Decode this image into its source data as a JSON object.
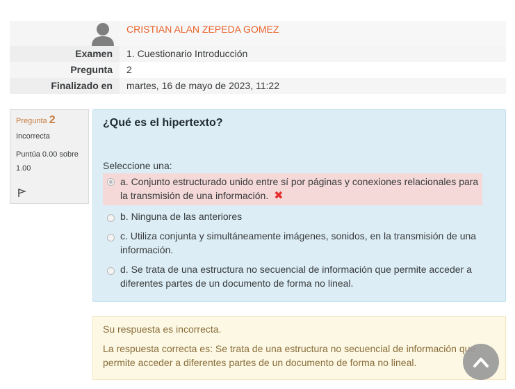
{
  "summary": {
    "user_name": "CRISTIAN ALAN ZEPEDA GOMEZ",
    "rows": [
      {
        "label": "Examen",
        "value": "1. Cuestionario Introducción"
      },
      {
        "label": "Pregunta",
        "value": "2"
      },
      {
        "label": "Finalizado en",
        "value": "martes, 16 de mayo de 2023, 11:22"
      }
    ]
  },
  "question_info": {
    "label": "Pregunta",
    "number": "2",
    "state": "Incorrecta",
    "grade": "Puntúa 0.00 sobre 1.00",
    "flag_icon": "flag-icon"
  },
  "question": {
    "text": "¿Qué es el hipertexto?",
    "prompt": "Seleccione una:",
    "answers": [
      {
        "text": "a. Conjunto estructurado unido entre sí por páginas y conexiones relacionales para la transmisión de una información.",
        "selected": true,
        "mark": "✖"
      },
      {
        "text": "b. Ninguna de las anteriores",
        "selected": false
      },
      {
        "text": "c. Utiliza conjunta y simultáneamente imágenes, sonidos, en la transmisión de una información.",
        "selected": false
      },
      {
        "text": "d. Se trata de una estructura no secuencial de información que permite acceder a diferentes partes de un documento de forma no lineal.",
        "selected": false
      }
    ]
  },
  "feedback": {
    "result": "Su respuesta es incorrecta.",
    "correct": "La respuesta correcta es: Se trata de una estructura no secuencial de información que permite acceder a diferentes partes de un documento de forma no lineal."
  },
  "colors": {
    "user_link": "#e8632b",
    "info_accent": "#c77b3f",
    "content_bg": "#dcedf5",
    "incorrect_bg": "#f5d9d8",
    "feedback_bg": "#fcf8e3",
    "feedback_text": "#8a6d3b"
  },
  "icons": {
    "avatar": "user-avatar-icon",
    "back_to_top": "chevron-up-icon"
  }
}
